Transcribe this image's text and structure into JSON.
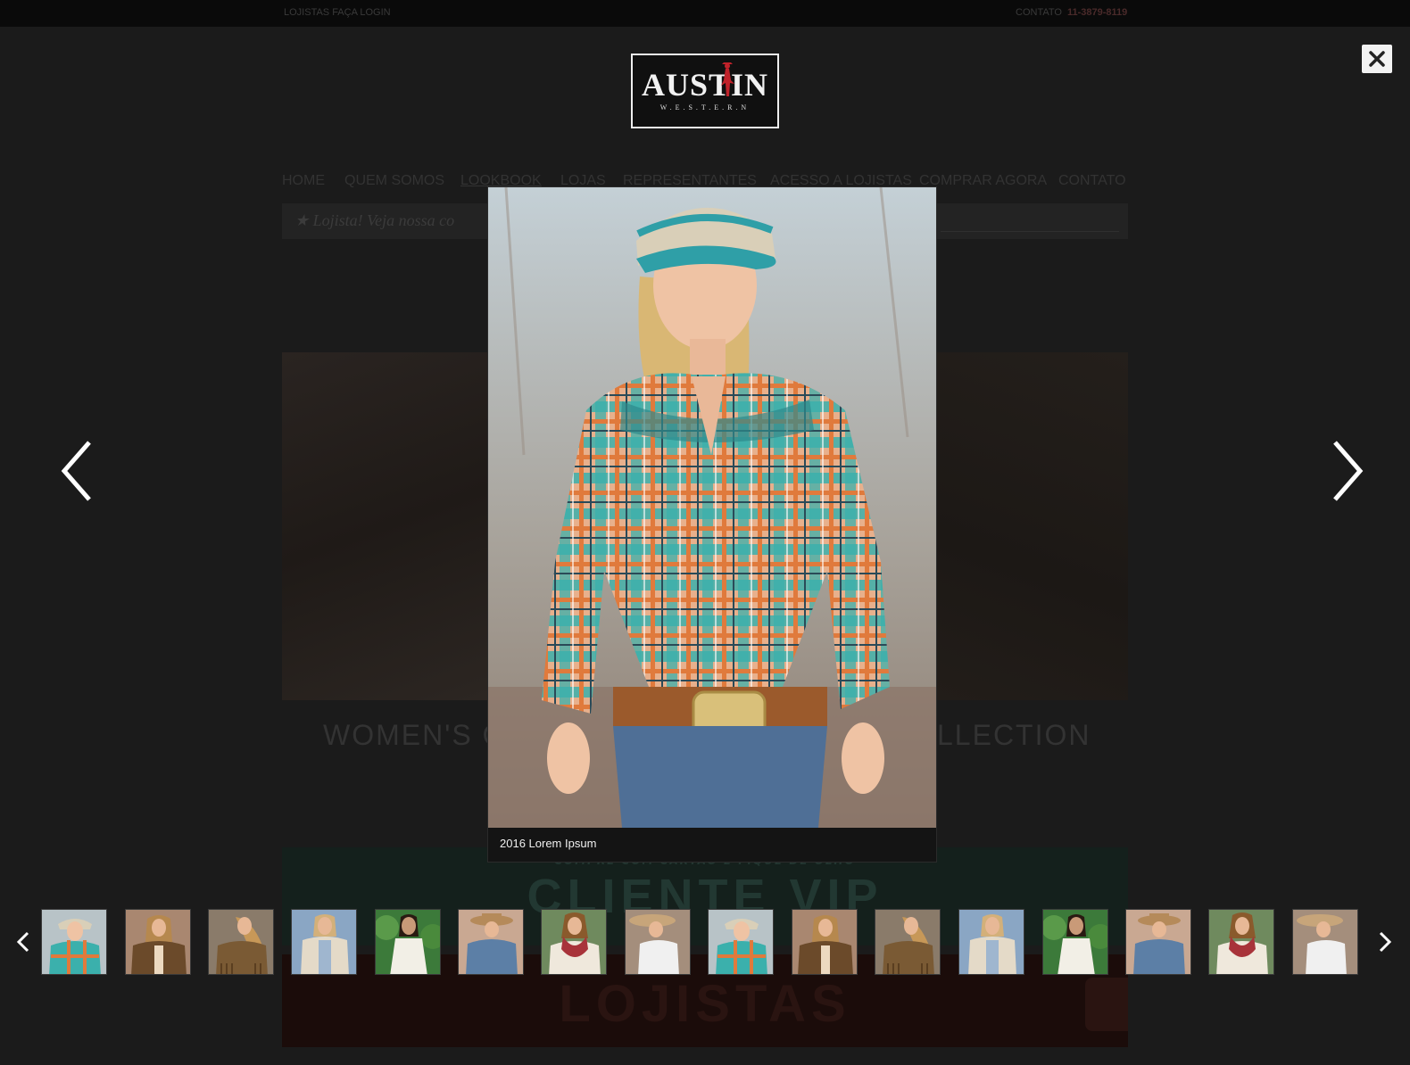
{
  "topbar": {
    "login_link": "LOJISTAS FAÇA LOGIN",
    "contact_label": "CONTATO",
    "phone": "11-3879-8119"
  },
  "logo": {
    "name": "AUSTIN",
    "sub": "W.E.S.T.E.R.N"
  },
  "nav": {
    "items": [
      "HOME",
      "QUEM SOMOS",
      "LOOKBOOK",
      "LOJAS",
      "REPRESENTANTES",
      "ACESSO A LOJISTAS",
      "COMPRAR AGORA",
      "CONTATO"
    ],
    "active": "LOOKBOOK"
  },
  "banner": {
    "text": "★ Lojista! Veja nossa co"
  },
  "collections": {
    "left": "WOMEN'S C",
    "right": "LLECTION"
  },
  "promo": {
    "vip_small": "COMPRE COM CARTÃO E FIQUE DE OLHO",
    "vip_big": "CLIENTE VIP",
    "lojistas_big": "LOJISTAS"
  },
  "lightbox": {
    "caption": "2016 Lorem Ipsum",
    "close_icon": "close-icon",
    "prev_icon": "chevron-left-icon",
    "next_icon": "chevron-right-icon"
  },
  "thumbnails": [
    {
      "subject": "plaid-shirt-cap",
      "active": true
    },
    {
      "subject": "brown-suede-jacket"
    },
    {
      "subject": "fringe-jacket"
    },
    {
      "subject": "cream-cardigan"
    },
    {
      "subject": "white-dress-greenery"
    },
    {
      "subject": "denim-shirt-hat"
    },
    {
      "subject": "red-scarf"
    },
    {
      "subject": "white-tank-hat"
    },
    {
      "subject": "plaid-shirt-cap"
    },
    {
      "subject": "brown-suede-jacket"
    },
    {
      "subject": "fringe-jacket"
    },
    {
      "subject": "cream-cardigan"
    },
    {
      "subject": "white-dress-greenery"
    },
    {
      "subject": "denim-shirt-hat"
    },
    {
      "subject": "red-scarf"
    },
    {
      "subject": "white-tank-hat"
    }
  ],
  "colors": {
    "overlay": "#1b1b1b",
    "accent_red": "#c0222a",
    "plaid_teal": "#3bb0ac",
    "plaid_orange": "#e07a3c"
  }
}
